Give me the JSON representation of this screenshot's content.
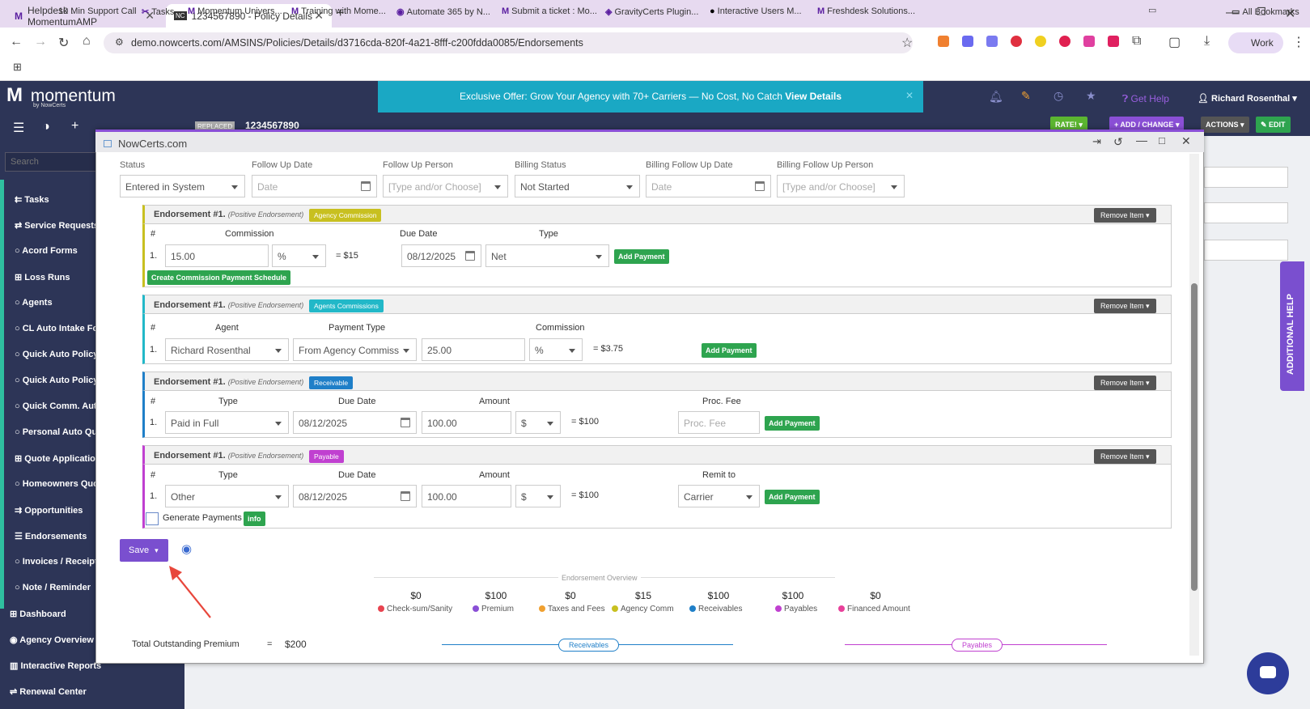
{
  "browser": {
    "tabs": [
      {
        "label": "Helpdesk : MomentumAMP"
      },
      {
        "label": "1234567890 - Policy Details - M"
      }
    ],
    "url": "demo.nowcerts.com/AMSINS/Policies/Details/d3716cda-820f-4a21-8fff-c200fdda0085/Endorsements",
    "profile": "Work",
    "bookmarks": [
      "10 Min Support Call",
      "Tasks",
      "Momentum Univers...",
      "Training with Mome...",
      "Automate 365 by N...",
      "Submit a ticket : Mo...",
      "GravityCerts Plugin...",
      "Interactive Users M...",
      "Freshdesk Solutions...",
      "All Bookmarks"
    ]
  },
  "app": {
    "logo": "momentum",
    "logo_sub": "by NowCerts",
    "promo_text": "Exclusive Offer: Grow Your Agency with 70+ Carriers — No Cost, No Catch ",
    "promo_link": "View Details",
    "get_help": "Get Help",
    "user": "Richard Rosenthal",
    "search_placeholder": "Search",
    "replaced_badge": "REPLACED",
    "policy_number": "1234567890",
    "header_buttons": {
      "rate": "RATE!",
      "add_change": "+ ADD / CHANGE",
      "actions": "ACTIONS",
      "edit": "EDIT"
    },
    "additional_help": "ADDITIONAL HELP",
    "sidebar": [
      "Tasks",
      "Service Requests",
      "Acord Forms",
      "Loss Runs",
      "Agents",
      "CL Auto Intake Fo",
      "Quick Auto Policy",
      "Quick Auto Policy",
      "Quick Comm. Aut",
      "Personal Auto Qu",
      "Quote Application",
      "Homeowners Quc",
      "Opportunities",
      "Endorsements",
      "Invoices / Receipt",
      "Note / Reminder",
      "Dashboard",
      "Agency Overview",
      "Interactive Reports",
      "Renewal Center"
    ]
  },
  "modal": {
    "title": "NowCerts.com",
    "top_fields": {
      "status_label": "Status",
      "status_value": "Entered in System",
      "follow_up_date_label": "Follow Up Date",
      "follow_up_date_ph": "Date",
      "follow_up_person_label": "Follow Up Person",
      "follow_up_person_ph": "[Type and/or Choose]",
      "billing_status_label": "Billing Status",
      "billing_status_value": "Not Started",
      "billing_follow_up_date_label": "Billing Follow Up Date",
      "billing_follow_up_date_ph": "Date",
      "billing_follow_up_person_label": "Billing Follow Up Person",
      "billing_follow_up_person_ph": "[Type and/or Choose]"
    },
    "common": {
      "endorsement_title": "Endorsement #1.",
      "endorsement_kind": "(Positive Endorsement)",
      "remove_item": "Remove Item",
      "add_payment": "Add Payment",
      "hash": "#",
      "row_num": "1."
    },
    "agency_commission": {
      "tag": "Agency Commission",
      "col_commission": "Commission",
      "col_due_date": "Due Date",
      "col_type": "Type",
      "commission": "15.00",
      "unit": "%",
      "result": "= $15",
      "due_date": "08/12/2025",
      "type": "Net",
      "schedule_button": "Create Commission Payment Schedule"
    },
    "agents_commissions": {
      "tag": "Agents Commissions",
      "col_agent": "Agent",
      "col_payment_type": "Payment Type",
      "col_commission": "Commission",
      "agent": "Richard Rosenthal",
      "payment_type": "From Agency Commiss",
      "commission": "25.00",
      "unit": "%",
      "result": "= $3.75"
    },
    "receivable": {
      "tag": "Receivable",
      "col_type": "Type",
      "col_due_date": "Due Date",
      "col_amount": "Amount",
      "col_proc_fee": "Proc. Fee",
      "type": "Paid in Full",
      "due_date": "08/12/2025",
      "amount": "100.00",
      "unit": "$",
      "result": "= $100",
      "proc_fee_ph": "Proc. Fee"
    },
    "payable": {
      "tag": "Payable",
      "col_type": "Type",
      "col_due_date": "Due Date",
      "col_amount": "Amount",
      "col_remit": "Remit to",
      "type": "Other",
      "due_date": "08/12/2025",
      "amount": "100.00",
      "unit": "$",
      "result": "= $100",
      "remit_to": "Carrier",
      "generate_payments": "Generate Payments",
      "info": "info"
    },
    "save": "Save",
    "overview": {
      "title": "Endorsement Overview",
      "items": [
        {
          "value": "$0",
          "label": "Check-sum/Sanity",
          "color": "#e8434f"
        },
        {
          "value": "$100",
          "label": "Premium",
          "color": "#8a4fd6"
        },
        {
          "value": "$0",
          "label": "Taxes and Fees",
          "color": "#f0a030"
        },
        {
          "value": "$15",
          "label": "Agency Comm",
          "color": "#c8c020"
        },
        {
          "value": "$100",
          "label": "Receivables",
          "color": "#1f7fc8"
        },
        {
          "value": "$100",
          "label": "Payables",
          "color": "#c040d0"
        },
        {
          "value": "$0",
          "label": "Financed Amount",
          "color": "#e8409a"
        }
      ]
    },
    "total_outstanding_label": "Total Outstanding Premium",
    "total_outstanding_eq": "=",
    "total_outstanding_value": "$200",
    "receivables_pill": "Receivables",
    "payables_pill": "Payables"
  },
  "colors": {
    "header": "#2d3557",
    "promo": "#1aa8c4",
    "accent_purple": "#8a4fd6",
    "agency_commission": "#c8c020",
    "agents_commissions": "#22b8c8",
    "receivable": "#1f7fc8",
    "payable": "#c040d0",
    "green": "#2ea44f"
  }
}
